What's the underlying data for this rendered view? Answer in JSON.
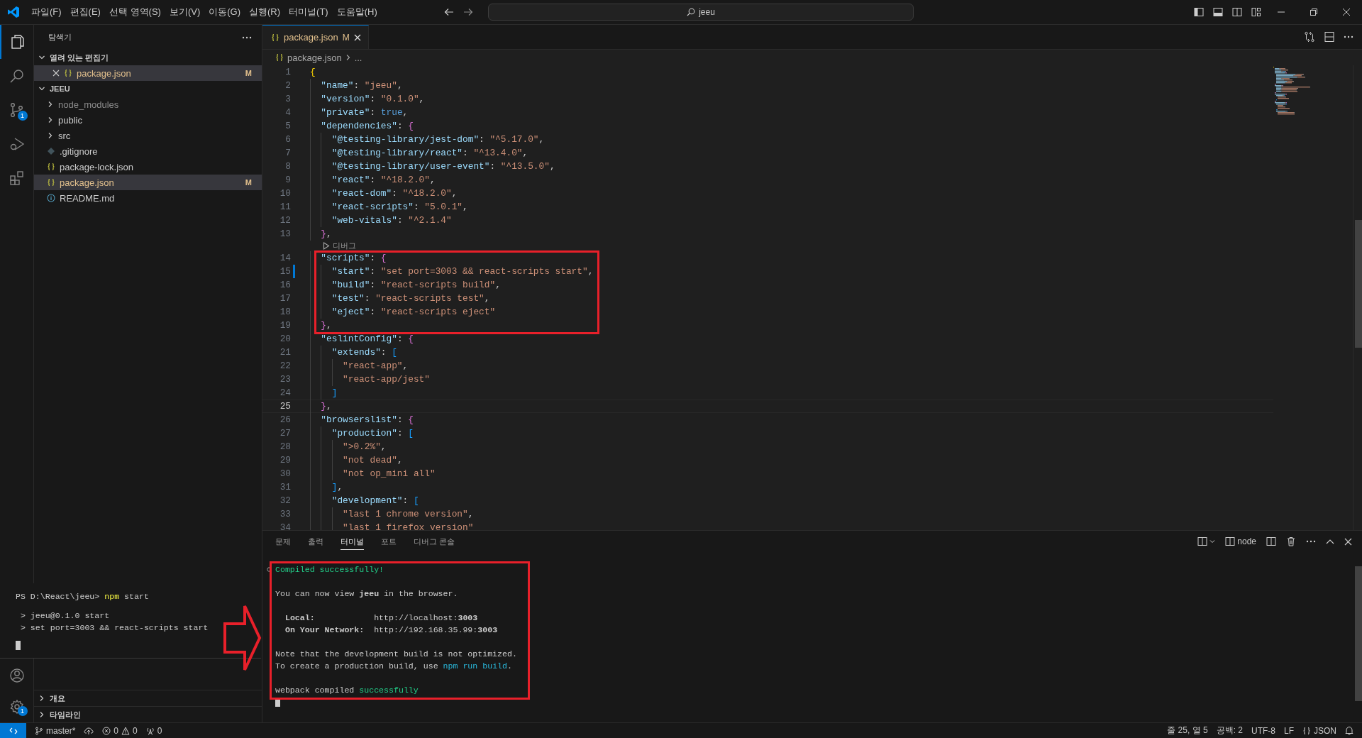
{
  "title_bar": {
    "menus": [
      "파일(F)",
      "편집(E)",
      "선택 영역(S)",
      "보기(V)",
      "이동(G)",
      "실행(R)",
      "터미널(T)",
      "도움말(H)"
    ],
    "search": {
      "value": "jeeu"
    }
  },
  "activity_bar": {
    "items": [
      {
        "kind": "explorer",
        "selected": true
      },
      {
        "kind": "search",
        "selected": false
      },
      {
        "kind": "source-control",
        "selected": false,
        "badge": "1"
      },
      {
        "kind": "run",
        "selected": false
      },
      {
        "kind": "extensions",
        "selected": false
      }
    ],
    "bottom": [
      {
        "kind": "account"
      },
      {
        "kind": "settings",
        "badge": "1"
      }
    ]
  },
  "sidebar": {
    "title": "탐색기",
    "open_editors": {
      "title": "열려 있는 편집기",
      "expanded": true,
      "items": [
        {
          "name": "package.json",
          "kind": "json",
          "status": "M",
          "selected": true
        }
      ]
    },
    "project": {
      "title": "JEEU",
      "expanded": true,
      "items": [
        {
          "name": "node_modules",
          "kind": "folder",
          "expanded": false,
          "dimmed": true,
          "selected": false
        },
        {
          "name": "public",
          "kind": "folder",
          "expanded": false,
          "dimmed": false,
          "selected": false
        },
        {
          "name": "src",
          "kind": "folder",
          "expanded": false,
          "dimmed": false,
          "selected": false
        },
        {
          "name": ".gitignore",
          "kind": "gitignore",
          "dimmed": false,
          "selected": false
        },
        {
          "name": "package-lock.json",
          "kind": "json",
          "dimmed": false,
          "selected": false
        },
        {
          "name": "package.json",
          "kind": "json",
          "status": "M",
          "dimmed": false,
          "selected": true
        },
        {
          "name": "README.md",
          "kind": "info",
          "dimmed": false,
          "selected": false
        }
      ]
    },
    "bottom_sections": [
      {
        "title": "개요",
        "expanded": false
      },
      {
        "title": "타임라인",
        "expanded": false
      }
    ]
  },
  "editor": {
    "tabs": [
      {
        "name": "package.json",
        "status": "M",
        "selected": true
      }
    ],
    "breadcrumb": [
      "package.json",
      "..."
    ],
    "lines": [
      {
        "number": "1",
        "current": false,
        "modified": false,
        "tokens": [
          {
            "kind": "brace1",
            "text": "{"
          }
        ]
      },
      {
        "number": "2",
        "current": false,
        "modified": false,
        "tokens": [
          {
            "kind": "key",
            "text": "  \"name\""
          },
          {
            "kind": "punct",
            "text": ": "
          },
          {
            "kind": "string",
            "text": "\"jeeu\""
          },
          {
            "kind": "punct",
            "text": ","
          }
        ]
      },
      {
        "number": "3",
        "current": false,
        "modified": false,
        "tokens": [
          {
            "kind": "key",
            "text": "  \"version\""
          },
          {
            "kind": "punct",
            "text": ": "
          },
          {
            "kind": "string",
            "text": "\"0.1.0\""
          },
          {
            "kind": "punct",
            "text": ","
          }
        ]
      },
      {
        "number": "4",
        "current": false,
        "modified": false,
        "tokens": [
          {
            "kind": "key",
            "text": "  \"private\""
          },
          {
            "kind": "punct",
            "text": ": "
          },
          {
            "kind": "keyword",
            "text": "true"
          },
          {
            "kind": "punct",
            "text": ","
          }
        ]
      },
      {
        "number": "5",
        "current": false,
        "modified": false,
        "tokens": [
          {
            "kind": "key",
            "text": "  \"dependencies\""
          },
          {
            "kind": "punct",
            "text": ": "
          },
          {
            "kind": "brace2",
            "text": "{"
          }
        ]
      },
      {
        "number": "6",
        "current": false,
        "modified": false,
        "tokens": [
          {
            "kind": "key",
            "text": "    \"@testing-library/jest-dom\""
          },
          {
            "kind": "punct",
            "text": ": "
          },
          {
            "kind": "string",
            "text": "\"^5.17.0\""
          },
          {
            "kind": "punct",
            "text": ","
          }
        ]
      },
      {
        "number": "7",
        "current": false,
        "modified": false,
        "tokens": [
          {
            "kind": "key",
            "text": "    \"@testing-library/react\""
          },
          {
            "kind": "punct",
            "text": ": "
          },
          {
            "kind": "string",
            "text": "\"^13.4.0\""
          },
          {
            "kind": "punct",
            "text": ","
          }
        ]
      },
      {
        "number": "8",
        "current": false,
        "modified": false,
        "tokens": [
          {
            "kind": "key",
            "text": "    \"@testing-library/user-event\""
          },
          {
            "kind": "punct",
            "text": ": "
          },
          {
            "kind": "string",
            "text": "\"^13.5.0\""
          },
          {
            "kind": "punct",
            "text": ","
          }
        ]
      },
      {
        "number": "9",
        "current": false,
        "modified": false,
        "tokens": [
          {
            "kind": "key",
            "text": "    \"react\""
          },
          {
            "kind": "punct",
            "text": ": "
          },
          {
            "kind": "string",
            "text": "\"^18.2.0\""
          },
          {
            "kind": "punct",
            "text": ","
          }
        ]
      },
      {
        "number": "10",
        "current": false,
        "modified": false,
        "tokens": [
          {
            "kind": "key",
            "text": "    \"react-dom\""
          },
          {
            "kind": "punct",
            "text": ": "
          },
          {
            "kind": "string",
            "text": "\"^18.2.0\""
          },
          {
            "kind": "punct",
            "text": ","
          }
        ]
      },
      {
        "number": "11",
        "current": false,
        "modified": false,
        "tokens": [
          {
            "kind": "key",
            "text": "    \"react-scripts\""
          },
          {
            "kind": "punct",
            "text": ": "
          },
          {
            "kind": "string",
            "text": "\"5.0.1\""
          },
          {
            "kind": "punct",
            "text": ","
          }
        ]
      },
      {
        "number": "12",
        "current": false,
        "modified": false,
        "tokens": [
          {
            "kind": "key",
            "text": "    \"web-vitals\""
          },
          {
            "kind": "punct",
            "text": ": "
          },
          {
            "kind": "string",
            "text": "\"^2.1.4\""
          }
        ]
      },
      {
        "number": "13",
        "current": false,
        "modified": false,
        "tokens": [
          {
            "kind": "brace2",
            "text": "  }"
          },
          {
            "kind": "punct",
            "text": ","
          }
        ]
      },
      {
        "number": "14",
        "current": false,
        "modified": false,
        "codelens": "디버그",
        "tokens": [
          {
            "kind": "key",
            "text": "  \"scripts\""
          },
          {
            "kind": "punct",
            "text": ": "
          },
          {
            "kind": "brace2",
            "text": "{"
          }
        ]
      },
      {
        "number": "15",
        "current": false,
        "modified": true,
        "tokens": [
          {
            "kind": "key",
            "text": "    \"start\""
          },
          {
            "kind": "punct",
            "text": ": "
          },
          {
            "kind": "string",
            "text": "\"set port=3003 && react-scripts start\""
          },
          {
            "kind": "punct",
            "text": ","
          }
        ]
      },
      {
        "number": "16",
        "current": false,
        "modified": false,
        "tokens": [
          {
            "kind": "key",
            "text": "    \"build\""
          },
          {
            "kind": "punct",
            "text": ": "
          },
          {
            "kind": "string",
            "text": "\"react-scripts build\""
          },
          {
            "kind": "punct",
            "text": ","
          }
        ]
      },
      {
        "number": "17",
        "current": false,
        "modified": false,
        "tokens": [
          {
            "kind": "key",
            "text": "    \"test\""
          },
          {
            "kind": "punct",
            "text": ": "
          },
          {
            "kind": "string",
            "text": "\"react-scripts test\""
          },
          {
            "kind": "punct",
            "text": ","
          }
        ]
      },
      {
        "number": "18",
        "current": false,
        "modified": false,
        "tokens": [
          {
            "kind": "key",
            "text": "    \"eject\""
          },
          {
            "kind": "punct",
            "text": ": "
          },
          {
            "kind": "string",
            "text": "\"react-scripts eject\""
          }
        ]
      },
      {
        "number": "19",
        "current": false,
        "modified": false,
        "tokens": [
          {
            "kind": "brace2",
            "text": "  }"
          },
          {
            "kind": "punct",
            "text": ","
          }
        ]
      },
      {
        "number": "20",
        "current": false,
        "modified": false,
        "tokens": [
          {
            "kind": "key",
            "text": "  \"eslintConfig\""
          },
          {
            "kind": "punct",
            "text": ": "
          },
          {
            "kind": "brace2",
            "text": "{"
          }
        ]
      },
      {
        "number": "21",
        "current": false,
        "modified": false,
        "tokens": [
          {
            "kind": "key",
            "text": "    \"extends\""
          },
          {
            "kind": "punct",
            "text": ": "
          },
          {
            "kind": "brace3",
            "text": "["
          }
        ]
      },
      {
        "number": "22",
        "current": false,
        "modified": false,
        "tokens": [
          {
            "kind": "string",
            "text": "      \"react-app\""
          },
          {
            "kind": "punct",
            "text": ","
          }
        ]
      },
      {
        "number": "23",
        "current": false,
        "modified": false,
        "tokens": [
          {
            "kind": "string",
            "text": "      \"react-app/jest\""
          }
        ]
      },
      {
        "number": "24",
        "current": false,
        "modified": false,
        "tokens": [
          {
            "kind": "brace3",
            "text": "    ]"
          }
        ]
      },
      {
        "number": "25",
        "current": true,
        "modified": false,
        "tokens": [
          {
            "kind": "brace2",
            "text": "  }"
          },
          {
            "kind": "punct",
            "text": ","
          }
        ]
      },
      {
        "number": "26",
        "current": false,
        "modified": false,
        "tokens": [
          {
            "kind": "key",
            "text": "  \"browserslist\""
          },
          {
            "kind": "punct",
            "text": ": "
          },
          {
            "kind": "brace2",
            "text": "{"
          }
        ]
      },
      {
        "number": "27",
        "current": false,
        "modified": false,
        "tokens": [
          {
            "kind": "key",
            "text": "    \"production\""
          },
          {
            "kind": "punct",
            "text": ": "
          },
          {
            "kind": "brace3",
            "text": "["
          }
        ]
      },
      {
        "number": "28",
        "current": false,
        "modified": false,
        "tokens": [
          {
            "kind": "string",
            "text": "      \">0.2%\""
          },
          {
            "kind": "punct",
            "text": ","
          }
        ]
      },
      {
        "number": "29",
        "current": false,
        "modified": false,
        "tokens": [
          {
            "kind": "string",
            "text": "      \"not dead\""
          },
          {
            "kind": "punct",
            "text": ","
          }
        ]
      },
      {
        "number": "30",
        "current": false,
        "modified": false,
        "tokens": [
          {
            "kind": "string",
            "text": "      \"not op_mini all\""
          }
        ]
      },
      {
        "number": "31",
        "current": false,
        "modified": false,
        "tokens": [
          {
            "kind": "brace3",
            "text": "    ]"
          },
          {
            "kind": "punct",
            "text": ","
          }
        ]
      },
      {
        "number": "32",
        "current": false,
        "modified": false,
        "tokens": [
          {
            "kind": "key",
            "text": "    \"development\""
          },
          {
            "kind": "punct",
            "text": ": "
          },
          {
            "kind": "brace3",
            "text": "["
          }
        ]
      },
      {
        "number": "33",
        "current": false,
        "modified": false,
        "tokens": [
          {
            "kind": "string",
            "text": "      \"last 1 chrome version\""
          },
          {
            "kind": "punct",
            "text": ","
          }
        ]
      },
      {
        "number": "34",
        "current": false,
        "modified": false,
        "tokens": [
          {
            "kind": "string",
            "text": "      \"last 1 firefox version\""
          }
        ]
      }
    ]
  },
  "panel": {
    "tabs": [
      {
        "label": "문제",
        "selected": false
      },
      {
        "label": "출력",
        "selected": false
      },
      {
        "label": "터미널",
        "selected": true
      },
      {
        "label": "포트",
        "selected": false
      },
      {
        "label": "디버그 콘솔",
        "selected": false
      }
    ],
    "terminal_name": "node",
    "paragraphs": [
      [
        [
          {
            "kind": "green",
            "text": "Compiled successfully!"
          }
        ]
      ],
      [
        [
          {
            "kind": "plain",
            "text": "You can now view **jeeu** in the browser."
          }
        ]
      ],
      [
        [
          {
            "kind": "plain",
            "text": "  **Local:**            http://localhost:**3003**"
          }
        ],
        [
          {
            "kind": "plain",
            "text": "  **On Your Network:**  http://192.168.35.99:**3003**"
          }
        ]
      ],
      [
        [
          {
            "kind": "plain",
            "text": "Note that the development build is not optimized."
          }
        ],
        [
          {
            "kind": "plain",
            "text": "To create a production build, use "
          },
          {
            "kind": "link",
            "text": "npm run build"
          },
          {
            "kind": "plain",
            "text": "."
          }
        ]
      ],
      [
        [
          {
            "kind": "plain",
            "text": "webpack compiled "
          },
          {
            "kind": "green",
            "text": "successfully"
          }
        ]
      ]
    ]
  },
  "overlay_terminal": {
    "paragraphs": [
      [
        [
          {
            "kind": "plain",
            "text": "PS D:\\React\\jeeu> "
          },
          {
            "kind": "command",
            "text": "npm"
          },
          {
            "kind": "plain",
            "text": " start"
          }
        ]
      ],
      [
        [
          {
            "kind": "plain",
            "text": " > jeeu@0.1.0 start"
          }
        ],
        [
          {
            "kind": "plain",
            "text": " > set port=3003 && react-scripts start"
          }
        ]
      ]
    ]
  },
  "annotations": [
    {
      "kind": "scripts-box"
    },
    {
      "kind": "terminal-box"
    },
    {
      "kind": "arrow"
    }
  ],
  "status_bar": {
    "branch": "master*",
    "errors": "0",
    "warnings": "0",
    "ports": "0",
    "items": [
      "줄 25, 열 5",
      "공백: 2",
      "UTF-8",
      "LF"
    ],
    "language": "JSON"
  }
}
